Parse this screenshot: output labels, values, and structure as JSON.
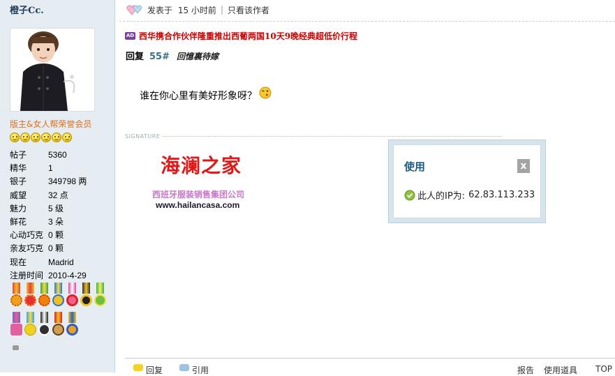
{
  "sidebar": {
    "username": "橙子Cc.",
    "rank_title": "版主&女人帮荣誉会员",
    "stars_count": 6,
    "stats": [
      {
        "label": "帖子",
        "value": "5360"
      },
      {
        "label": "精华",
        "value": "1"
      },
      {
        "label": "银子",
        "value": "349798 两"
      },
      {
        "label": "威望",
        "value": "32 点"
      },
      {
        "label": "魅力",
        "value": "5 级"
      },
      {
        "label": "鲜花",
        "value": "3 朵"
      },
      {
        "label": "心动巧克",
        "value": "0 颗"
      },
      {
        "label": "亲友巧克",
        "value": "0 颗"
      },
      {
        "label": "现在",
        "value": "Madrid"
      },
      {
        "label": "注册时间",
        "value": "2010-4-29"
      }
    ]
  },
  "post": {
    "posted_label": "发表于",
    "posted_time": "15 小时前",
    "separator": "|",
    "author_only": "只看该作者",
    "ad_badge": "AD",
    "ad_text": "西华携合作伙伴隆重推出西葡两国10天9晚经典超低价行程",
    "reply_label": "回复",
    "reply_floor": "55#",
    "reply_to": "回憶裏待嫁",
    "content": "谁在你心里有美好形象呀？"
  },
  "signature": {
    "label": "SIGNATURE",
    "logo_title": "海澜之家",
    "logo_subtitle": "西班牙服装销售集团公司",
    "url": "www.hailancasa.com"
  },
  "ip_popup": {
    "title": "使用",
    "close_label": "x",
    "ip_label": "此人的IP为:",
    "ip_value": "62.83.113.233"
  },
  "bottom_bar": {
    "reply": "回复",
    "quote": "引用",
    "report": "报告",
    "use_item": "使用道具",
    "top": "TOP"
  },
  "colors": {
    "sidebar_bg": "#e5edf2",
    "ad_red": "#cc0000",
    "logo_red": "#e01818",
    "floor_blue": "#3a6e8c",
    "popup_title": "#1e5a80"
  }
}
